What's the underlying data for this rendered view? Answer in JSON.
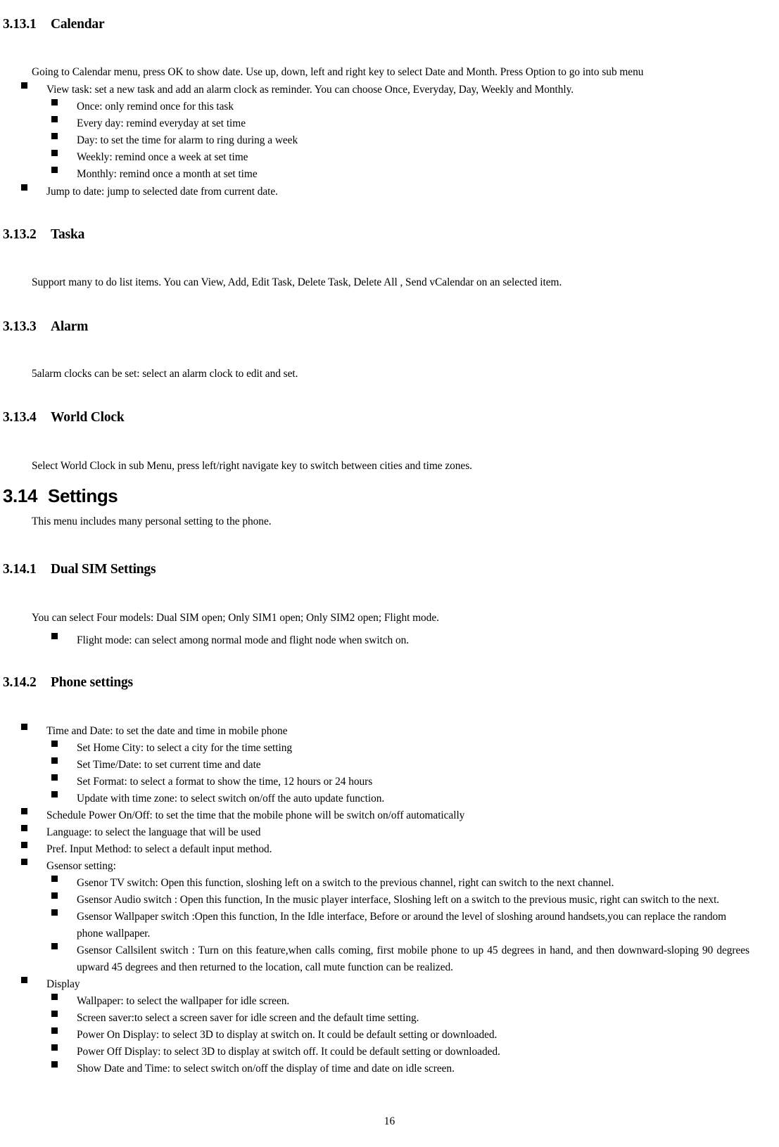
{
  "document": {
    "page_number": "16",
    "sections": [
      {
        "id": "calendar",
        "number": "3.13.1",
        "title": "Calendar",
        "intro": "Going to Calendar menu, press OK to show date. Use up, down, left and right key to select Date and Month. Press Option to go into sub menu",
        "bullets": [
          "View task: set a new task and add an alarm clock as reminder. You can choose Once, Everyday, Day, Weekly and Monthly.",
          "Once: only remind once for this task",
          "Every day: remind everyday at set time",
          "Day: to set the time for alarm to ring during a week",
          "Weekly: remind once a week at set time",
          "Monthly: remind once a month at set time",
          "Jump to date: jump to selected date from current date."
        ]
      },
      {
        "id": "taska",
        "number": "3.13.2",
        "title": "Taska",
        "intro": "Support many to do list items. You can View, Add, Edit Task, Delete Task, Delete All , Send vCalendar on an selected item."
      },
      {
        "id": "alarm",
        "number": "3.13.3",
        "title": "Alarm",
        "intro": "5alarm clocks can be set: select an alarm clock to edit and set."
      },
      {
        "id": "world-clock",
        "number": "3.13.4",
        "title": "World Clock",
        "intro": "Select World Clock in sub Menu, press left/right navigate key to switch between cities and time zones."
      },
      {
        "id": "settings",
        "number": "3.14",
        "title": "Settings",
        "intro": "This menu includes many personal setting to the phone."
      },
      {
        "id": "dual-sim-settings",
        "number": "3.14.1",
        "title": "Dual SIM Settings",
        "intro": "You can select Four models: Dual SIM open; Only SIM1 open; Only SIM2 open; Flight mode.",
        "bullets": [
          "Flight mode: can select among normal mode and flight node when switch on."
        ]
      },
      {
        "id": "phone-settings",
        "number": "3.14.2",
        "title": "Phone settings",
        "bullets": [
          "Time and Date: to set the date and time in mobile phone",
          "Set Home City: to select a city for the time setting",
          "Set Time/Date: to set current time and date",
          "Set Format: to select a format to show the time, 12 hours or 24 hours",
          "Update with time zone: to select switch on/off the auto update function.",
          "Schedule Power On/Off: to set the time that the mobile phone will be switch on/off automatically",
          "Language: to select the language that will be used",
          "Pref. Input Method: to select a default input method.",
          "Gsensor setting:",
          "Gsenor TV switch: Open this function, sloshing left on a switch to the previous channel, right can switch to the next channel.",
          "Gsensor Audio switch : Open this function, In the music player interface, Sloshing left on a switch to the previous music, right can switch to the next.",
          "Gsensor Wallpaper switch :Open this function, In the Idle interface, Before or around the level of sloshing around handsets,you can replace the random phone wallpaper.",
          "Gsensor Callsilent switch : Turn on this feature,when calls coming, first mobile phone to up 45 degrees in hand, and then downward-sloping 90 degrees upward 45 degrees and then returned to the location, call mute function can be realized.",
          "Display",
          "Wallpaper: to select the wallpaper for idle screen.",
          "Screen saver:to select a screen saver for idle screen and the default time setting.",
          "Power On Display: to select 3D to display at switch on. It could be default setting or downloaded.",
          "Power Off Display: to select 3D to display at switch off. It could be default setting or downloaded.",
          "Show Date and Time: to select switch on/off the display of time and date on idle screen."
        ]
      }
    ]
  }
}
